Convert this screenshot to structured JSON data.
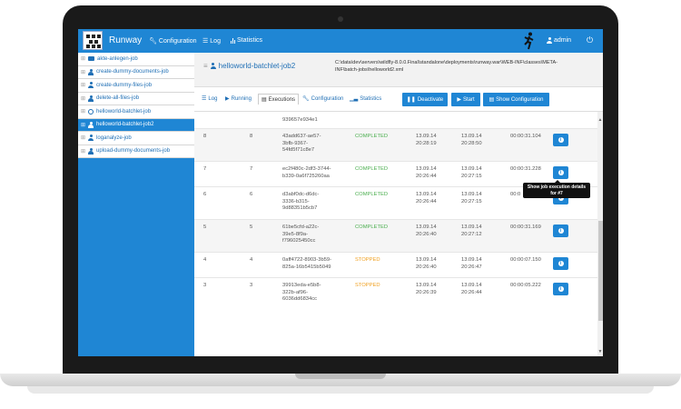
{
  "app": {
    "title": "Runway"
  },
  "nav": {
    "configuration": "Configuration",
    "log": "Log",
    "statistics": "Statistics",
    "user": "admin"
  },
  "sidebar": {
    "items": [
      {
        "label": "akte-anlegen-job"
      },
      {
        "label": "create-dummy-documents-job"
      },
      {
        "label": "create-dummy-files-job"
      },
      {
        "label": "delete-all-files-job"
      },
      {
        "label": "helloworld-batchlet-job"
      },
      {
        "label": "helloworld-batchlet-job2"
      },
      {
        "label": "loganalyze-job"
      },
      {
        "label": "upload-dummy-documents-job"
      }
    ]
  },
  "job": {
    "title": "helloworld-batchlet-job2",
    "path": "C:\\data\\dev\\servers\\wildfly-8.0.0.Final\\standalone\\deployments\\runway.war\\WEB-INF\\classes\\META-INF\\batch-jobs\\helloworld2.xml"
  },
  "tabs": {
    "log": "Log",
    "running": "Running",
    "executions": "Executions",
    "configuration": "Configuration",
    "statistics": "Statistics"
  },
  "buttons": {
    "deactivate": "Deactivate",
    "start": "Start",
    "show_configuration": "Show Configuration"
  },
  "executions": {
    "partial_top": "939657e934e1",
    "rows": [
      {
        "id": "8",
        "instance": "8",
        "uuid": [
          "43add637-ae57-",
          "3bfb-9367-",
          "54fd5f71c8e7"
        ],
        "status": "COMPLETED",
        "start": [
          "13.09.14",
          "20:28:19"
        ],
        "end": [
          "13.09.14",
          "20:28:50"
        ],
        "duration": "00:00:31.104"
      },
      {
        "id": "7",
        "instance": "7",
        "uuid": [
          "ec2f480c-2df3-3744-",
          "b339-0a6f725260aa"
        ],
        "status": "COMPLETED",
        "start": [
          "13.09.14",
          "20:26:44"
        ],
        "end": [
          "13.09.14",
          "20:27:15"
        ],
        "duration": "00:00:31.228"
      },
      {
        "id": "6",
        "instance": "6",
        "uuid": [
          "d3abf0dc-d6dc-",
          "3336-b315-",
          "9d88351b5cb7"
        ],
        "status": "COMPLETED",
        "start": [
          "13.09.14",
          "20:26:44"
        ],
        "end": [
          "13.09.14",
          "20:27:15"
        ],
        "duration": "00:0"
      },
      {
        "id": "5",
        "instance": "5",
        "uuid": [
          "61be5cfd-a22c-",
          "39e5-8f9a-",
          "f796025450cc"
        ],
        "status": "COMPLETED",
        "start": [
          "13.09.14",
          "20:26:40"
        ],
        "end": [
          "13.09.14",
          "20:27:12"
        ],
        "duration": "00:00:31.169"
      },
      {
        "id": "4",
        "instance": "4",
        "uuid": [
          "0aff4722-8903-3b59-",
          "825a-16b5415b5049"
        ],
        "status": "STOPPED",
        "start": [
          "13.09.14",
          "20:26:40"
        ],
        "end": [
          "13.09.14",
          "20:26:47"
        ],
        "duration": "00:00:07.150"
      },
      {
        "id": "3",
        "instance": "3",
        "uuid": [
          "39913eda-e5b8-",
          "322b-af96-",
          "6036dd6834cc"
        ],
        "status": "STOPPED",
        "start": [
          "13.09.14",
          "20:26:39"
        ],
        "end": [
          "13.09.14",
          "20:26:44"
        ],
        "duration": "00:00:05.222"
      }
    ]
  },
  "tooltip": {
    "line1": "Show job execution details",
    "line2": "for #7"
  },
  "colors": {
    "accent": "#1f86d4",
    "completed": "#4caf50",
    "stopped": "#f0a020"
  }
}
